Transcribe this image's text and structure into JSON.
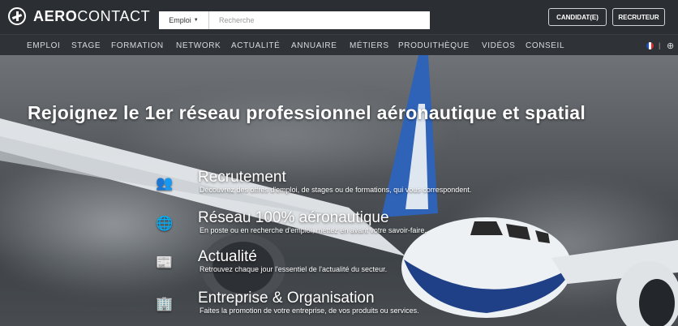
{
  "brand": {
    "bold": "AERO",
    "light": "CONTACT"
  },
  "search": {
    "category": "Emploi",
    "placeholder": "Recherche",
    "value": ""
  },
  "header_buttons": {
    "candidate": "CANDIDAT(E)",
    "recruiter": "RECRUTEUR"
  },
  "nav": {
    "items": [
      "EMPLOI",
      "STAGE",
      "FORMATION",
      "NETWORK",
      "ACTUALITÉ",
      "ANNUAIRE",
      "MÉTIERS",
      "PRODUITHÈQUE",
      "VIDÉOS",
      "CONSEIL"
    ],
    "separator": "|",
    "language_icon": "french-flag-icon",
    "globe_icon": "globe-icon"
  },
  "hero": {
    "title": "Rejoignez le 1er réseau professionnel aéronautique et spatial",
    "features": [
      {
        "icon": "people-icon",
        "title": "Recrutement",
        "desc": "Découvrez des offres d'emploi, de stages ou de formations, qui vous correspondent."
      },
      {
        "icon": "globe-icon",
        "title": "Réseau 100% aéronautique",
        "desc": "En poste ou en recherche d'emploi, mettez en avant votre savoir-faire."
      },
      {
        "icon": "newspaper-icon",
        "title": "Actualité",
        "desc": "Retrouvez chaque jour l'essentiel de l'actualité du secteur."
      },
      {
        "icon": "building-person-icon",
        "title": "Entreprise & Organisation",
        "desc": "Faites la promotion de votre entreprise, de vos produits ou services."
      }
    ]
  },
  "colors": {
    "header_bg": "#2b2f33",
    "nav_bg": "#2f3338",
    "text": "#ffffff"
  }
}
